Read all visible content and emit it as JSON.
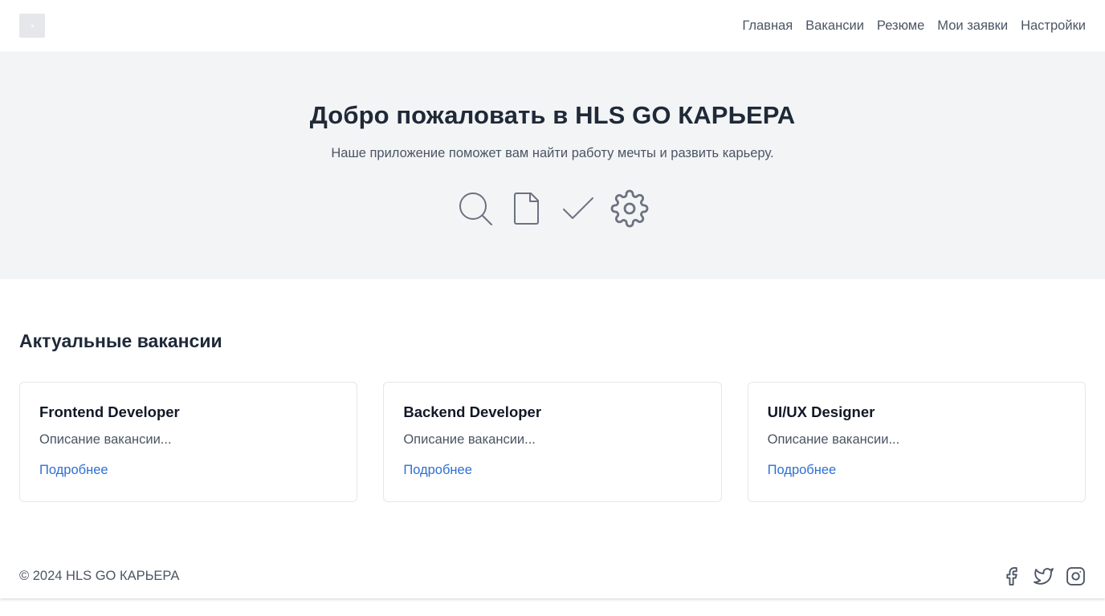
{
  "header": {
    "logo_icon": "logo-placeholder",
    "nav": [
      {
        "label": "Главная"
      },
      {
        "label": "Вакансии"
      },
      {
        "label": "Резюме"
      },
      {
        "label": "Мои заявки"
      },
      {
        "label": "Настройки"
      }
    ]
  },
  "hero": {
    "title": "Добро пожаловать в HLS GO КАРЬЕРА",
    "subtitle": "Наше приложение поможет вам найти работу мечты и развить карьеру.",
    "icons": [
      "search-icon",
      "document-icon",
      "check-icon",
      "gear-icon"
    ]
  },
  "vacancies": {
    "title": "Актуальные вакансии",
    "items": [
      {
        "title": "Frontend Developer",
        "description": "Описание вакансии...",
        "link": "Подробнее"
      },
      {
        "title": "Backend Developer",
        "description": "Описание вакансии...",
        "link": "Подробнее"
      },
      {
        "title": "UI/UX Designer",
        "description": "Описание вакансии...",
        "link": "Подробнее"
      }
    ]
  },
  "footer": {
    "copyright": "© 2024 HLS GO КАРЬЕРА",
    "social": [
      "facebook-icon",
      "twitter-icon",
      "instagram-icon"
    ]
  },
  "colors": {
    "hero_bg": "#f3f4f6",
    "link": "#2f6fd0",
    "text": "#1f2937",
    "muted": "#4b5563",
    "icon": "#6b7280"
  }
}
